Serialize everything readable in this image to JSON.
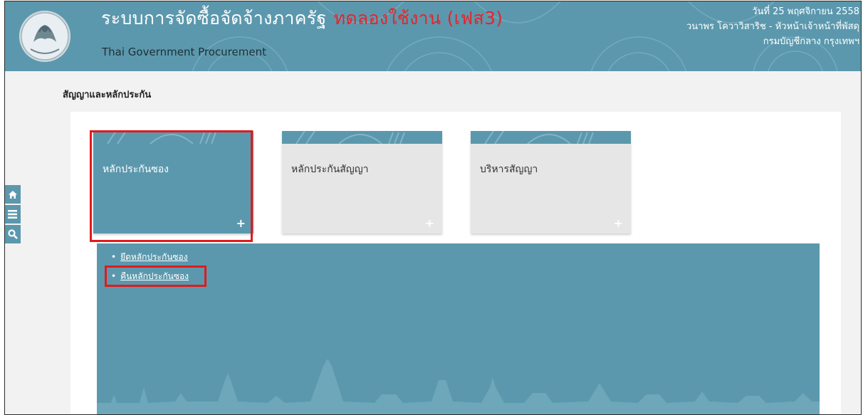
{
  "header": {
    "title": "ระบบการจัดซื้อจัดจ้างภาครัฐ",
    "trial_label": "ทดลองใช้งาน (เฟส3)",
    "subtitle": "Thai Government Procurement",
    "date": "วันที่ 25 พฤศจิกายน 2558",
    "user": "วนาพร โควาวิสาริช - หัวหน้าเจ้าหน้าที่พัสดุ",
    "department": "กรมบัญชีกลาง กรุงเทพฯ",
    "logo_icon": "comptroller-general-emblem-icon"
  },
  "side_icons": [
    "home-icon",
    "menu-icon",
    "search-icon"
  ],
  "section_title": "สัญญาและหลักประกัน",
  "tiles": [
    {
      "label": "หลักประกันซอง",
      "plus": "+",
      "active": true
    },
    {
      "label": "หลักประกันสัญญา",
      "plus": "+",
      "active": false
    },
    {
      "label": "บริหารสัญญา",
      "plus": "+",
      "active": false
    }
  ],
  "submenu": {
    "items": [
      {
        "bullet": "•",
        "label": "ยึดหลักประกันซอง"
      },
      {
        "bullet": "•",
        "label": "คืนหลักประกันซอง"
      }
    ]
  },
  "colors": {
    "primary": "#5b98ad",
    "highlight": "#e01b1b",
    "trial_text": "#e6242b"
  }
}
